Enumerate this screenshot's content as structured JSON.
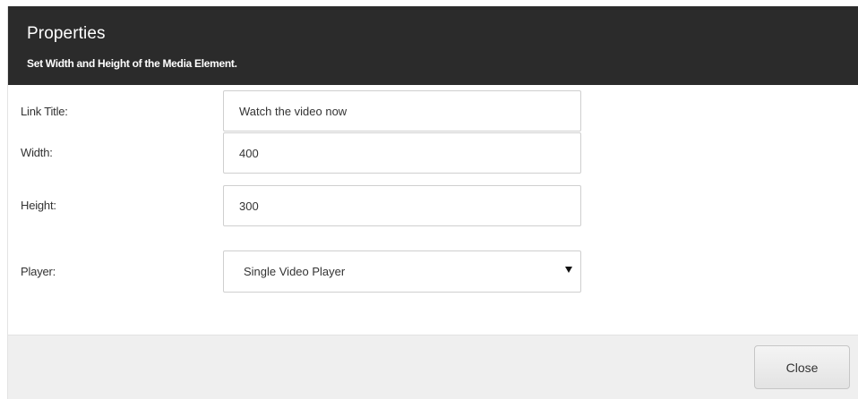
{
  "dialog": {
    "title": "Properties",
    "subtitle": "Set Width and Height of the Media Element."
  },
  "form": {
    "link_title": {
      "label": "Link Title:",
      "value": "Watch the video now"
    },
    "width": {
      "label": "Width:",
      "value": "400"
    },
    "height": {
      "label": "Height:",
      "value": "300"
    },
    "player": {
      "label": "Player:",
      "selected": "Single Video Player",
      "icon": "dropdown-arrow-icon"
    }
  },
  "footer": {
    "close_label": "Close"
  },
  "colors": {
    "header_background": "#2b2b2b",
    "footer_background": "#efefef",
    "field_border": "#cfcfcf"
  }
}
